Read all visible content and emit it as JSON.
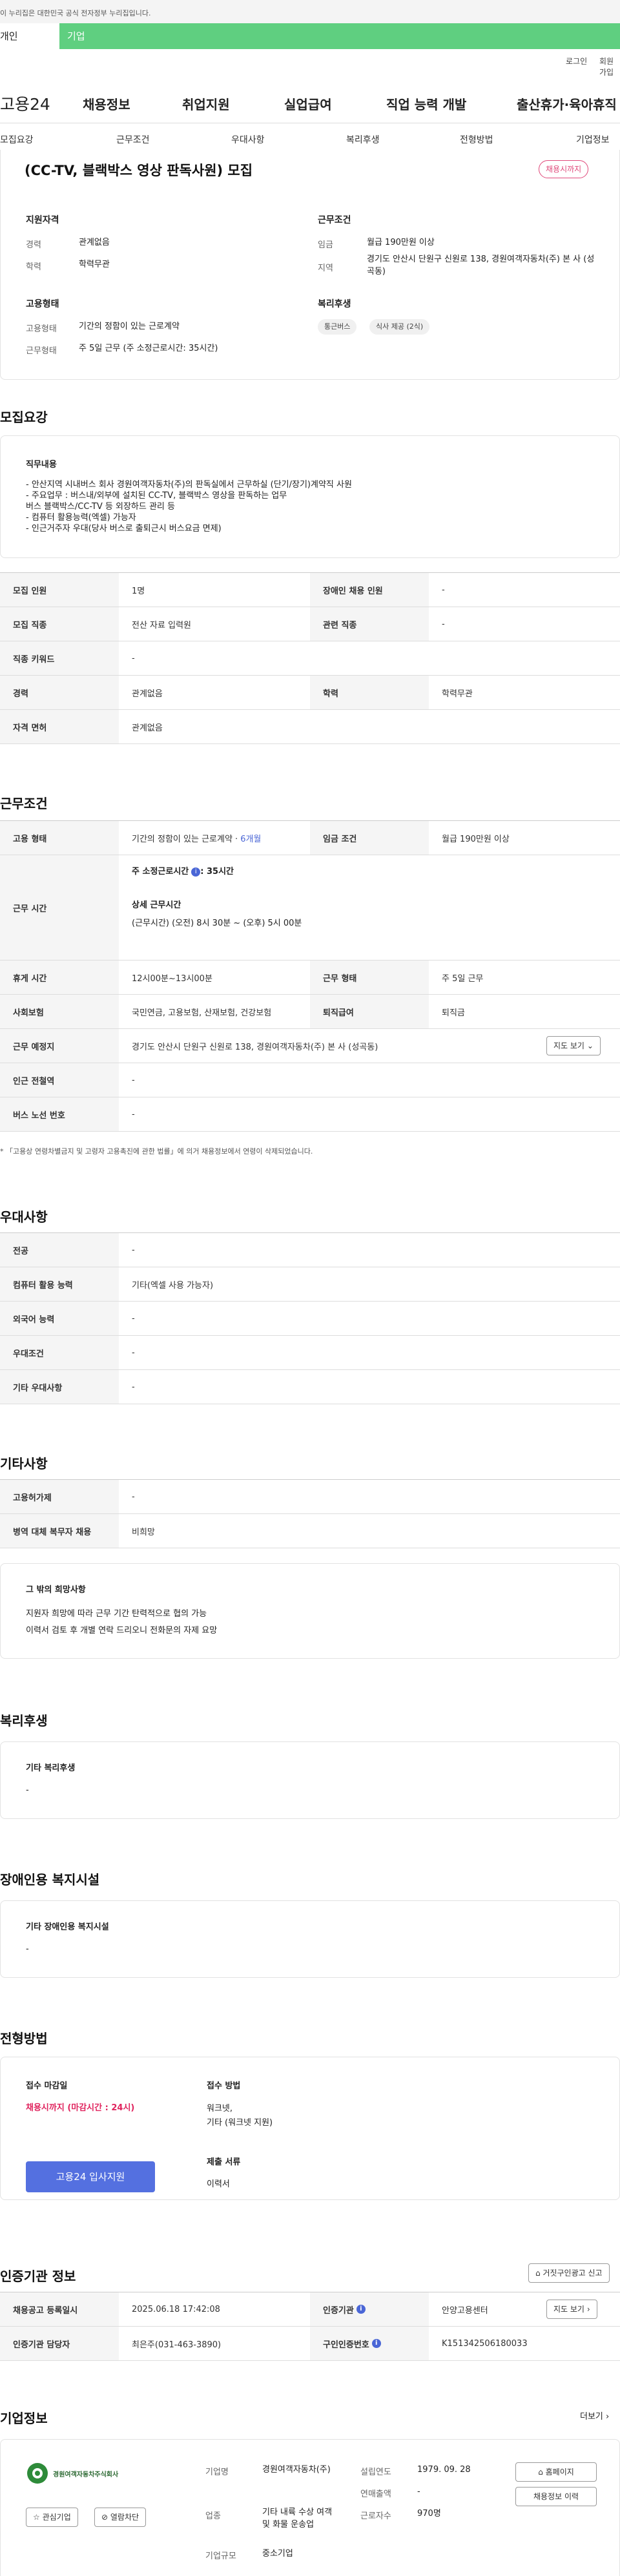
{
  "gov_banner": "이 누리집은 대한민국 공식 전자정부 누리집입니다.",
  "tabs": {
    "individual": "개인",
    "company": "기업"
  },
  "util": {
    "login": "로그인",
    "join": "회원가입"
  },
  "logo": "고용24",
  "gnb": [
    "채용정보",
    "취업지원",
    "실업급여",
    "직업 능력 개발",
    "출산휴가·육아휴직"
  ],
  "subnav": [
    "모집요강",
    "근무조건",
    "우대사항",
    "복리후생",
    "전형방법",
    "기업정보"
  ],
  "summary": {
    "title": "(CC-TV, 블랙박스 영상 판독사원) 모집",
    "badge": "채용시까지",
    "qual_title": "지원자격",
    "career_label": "경력",
    "career": "관계없음",
    "edu_label": "학력",
    "edu": "학력무관",
    "work_title": "근무조건",
    "wage_label": "임금",
    "wage": "월급 190만원 이상",
    "area_label": "지역",
    "area": "경기도 안산시 단원구 신원로 138, 경원여객자동차(주) 본 사 (성곡동)",
    "emp_title": "고용형태",
    "emp_label": "고용형태",
    "emp": "기간의 정함이 있는 근로계약",
    "work_type_label": "근무형태",
    "work_type": "주 5일 근무 (주 소정근로시간: 35시간)",
    "welfare_title": "복리후생",
    "chips": [
      "통근버스",
      "식사 제공 (2식)"
    ]
  },
  "recruit": {
    "section_title": "모집요강",
    "duty_title": "직무내용",
    "duty_text": "- 안산지역 시내버스 회사 경원여객자동차(주)의 판독실에서 근무하실 (단기/장기)계약직 사원\n- 주요업무 : 버스내/외부에 설치된 CC-TV, 블랙박스 영상을 판독하는 업무\n                  버스 블랙박스/CC-TV 등 외장하드 관리 등\n- 컴퓨터 활용능력(엑셀) 가능자\n- 인근거주자 우대(당사 버스로 출퇴근시 버스요금 면제)",
    "rows": [
      {
        "l1": "모집 인원",
        "v1": "1명",
        "l2": "장애인 채용 인원",
        "v2": "-"
      },
      {
        "l1": "모집 직종",
        "v1": "전산 자료 입력원",
        "l2": "관련 직종",
        "v2": "-"
      },
      {
        "l1": "직종 키워드",
        "v1": "-"
      },
      {
        "l1": "경력",
        "v1": "관계없음",
        "l2": "학력",
        "v2": "학력무관"
      },
      {
        "l1": "자격 면허",
        "v1": "관계없음"
      }
    ]
  },
  "cond": {
    "section_title": "근무조건",
    "emp_label": "고용 형태",
    "emp": "기간의 정함이 있는 근로계약 · ",
    "emp_months": "6개월",
    "wage_label": "임금 조건",
    "wage": "월급 190만원 이상",
    "hours_label": "근무 시간",
    "hours_week": "주 소정근로시간",
    "hours_week_val": ": 35시간",
    "hours_detail_title": "상세 근무시간",
    "hours_detail": "(근무시간) (오전) 8시 30분 ~ (오후) 5시 00분",
    "break_label": "휴게 시간",
    "break": "12시00분~13시00분",
    "form_label": "근무 형태",
    "form": "주 5일 근무",
    "ins_label": "사회보험",
    "ins": "국민연금, 고용보험, 산재보험, 건강보험",
    "sev_label": "퇴직급여",
    "sev": "퇴직금",
    "place_label": "근무 예정지",
    "place": "경기도 안산시 단원구 신원로 138, 경원여객자동차(주) 본 사 (성곡동)",
    "map_btn": "지도 보기",
    "station_label": "인근 전철역",
    "station": "-",
    "bus_label": "버스 노선 번호",
    "bus": "-",
    "note": "* 「고용상 연령차별금지 및 고령자 고용촉진에 관한 법률」에 의거 채용정보에서 연령이 삭제되었습니다."
  },
  "pref": {
    "section_title": "우대사항",
    "rows": [
      {
        "l": "전공",
        "v": "-"
      },
      {
        "l": "컴퓨터 활용 능력",
        "v": "기타(엑셀 사용 가능자)"
      },
      {
        "l": "외국어 능력",
        "v": "-"
      },
      {
        "l": "우대조건",
        "v": "-"
      },
      {
        "l": "기타 우대사항",
        "v": "-"
      }
    ]
  },
  "etc": {
    "section_title": "기타사항",
    "rows": [
      {
        "l": "고용허가제",
        "v": "-"
      },
      {
        "l": "병역 대체 복무자 채용",
        "v": "비희망"
      }
    ],
    "box_title": "그 밖의 희망사항",
    "box_text": "지원자 희망에 따라 근무 기간 탄력적으로 협의 가능\n이력서 검토 후 개별 연락 드리오니 전화문의 자제 요망"
  },
  "welfare": {
    "section_title": "복리후생",
    "box_title": "기타 복리후생",
    "box_val": "-"
  },
  "disab": {
    "section_title": "장애인용 복지시설",
    "box_title": "기타 장애인용 복지시설",
    "box_val": "-"
  },
  "apply": {
    "section_title": "전형방법",
    "deadline_title": "접수 마감일",
    "deadline": "채용시까지 (마감시간 : 24시)",
    "method_title": "접수 방법",
    "method": "워크넷,\n기타 (워크넷 지원)",
    "docs_title": "제출 서류",
    "docs": "이력서",
    "apply_btn": "고용24 입사지원"
  },
  "agency": {
    "section_title": "인증기관 정보",
    "report_btn": "거짓구인광고 신고",
    "reg_label": "채용공고 등록일시",
    "reg": "2025.06.18 17:42:08",
    "org_label": "인증기관",
    "org": "안양고용센터",
    "map_btn": "지도 보기",
    "mgr_label": "인증기관 담당자",
    "mgr": "최은주(031-463-3890)",
    "id_label": "구인인증번호",
    "id": "K151342506180033"
  },
  "company": {
    "section_title": "기업정보",
    "more": "더보기",
    "logo_text": "경원여객자동차주식회사",
    "fav_btn": "관심기업",
    "block_btn": "열람차단",
    "name_label": "기업명",
    "name": "경원여객자동차(주)",
    "ind_label": "업종",
    "ind": "기타 내륙 수상 여객 및 화물 운송업",
    "scale_label": "기업규모",
    "scale": "중소기업",
    "est_label": "설립연도",
    "est": "1979. 09. 28",
    "sales_label": "연매출액",
    "sales": "-",
    "staff_label": "근로자수",
    "staff": "970명",
    "home_btn": "홈페이지",
    "jobs_btn": "채용정보 이력"
  },
  "colors": {
    "accent": "#5470e0",
    "brand_green": "#5fcf80",
    "badge": "#e04a7b"
  }
}
